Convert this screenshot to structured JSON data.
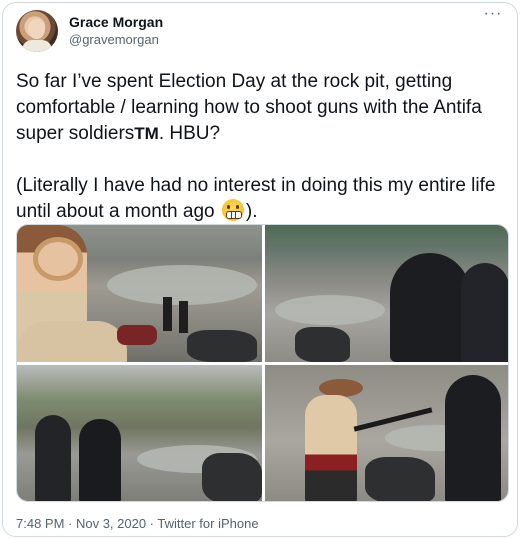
{
  "tweet": {
    "author_name": "Grace Morgan",
    "author_handle": "@gravemorgan",
    "more_glyph": "···",
    "text_part1": "So far I’ve spent Election Day at the rock pit, getting comfortable / learning how to shoot guns with the Antifa super soldiers",
    "trademark": "TM",
    "text_part2": ". HBU?\n\n(Literally I have had no interest in doing this my entire life until about a month ago ",
    "text_part3": ").",
    "emoji": "grimacing-face-emoji",
    "timestamp": "7:48 PM · Nov 3, 2020 · Twitter for iPhone"
  },
  "media": {
    "photo_count": 4
  }
}
